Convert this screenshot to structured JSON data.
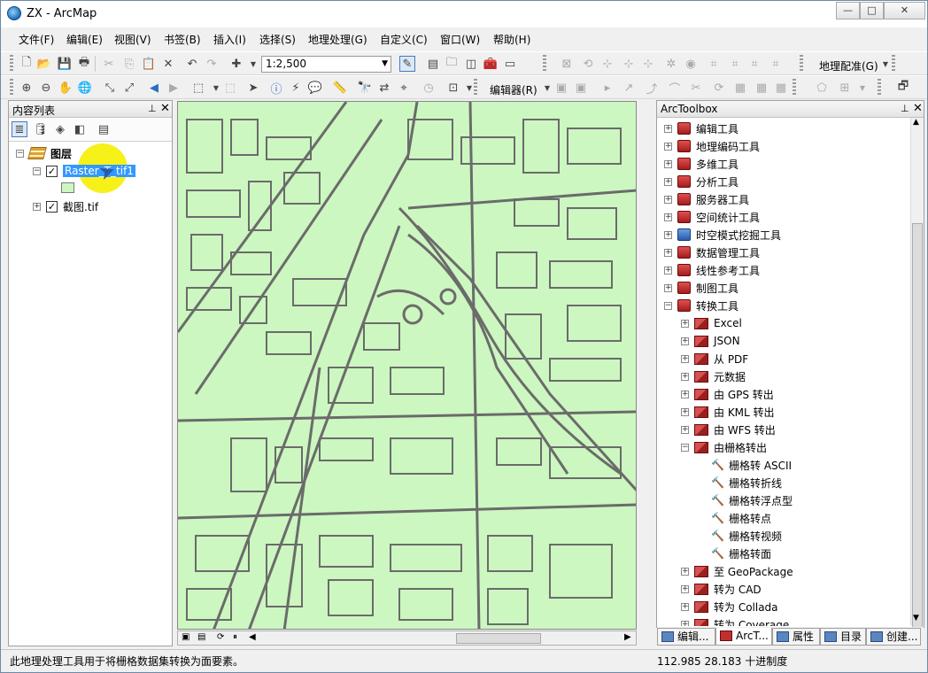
{
  "window": {
    "title": "ZX - ArcMap",
    "min": "—",
    "max": "□",
    "close": "✕"
  },
  "menu": [
    "文件(F)",
    "编辑(E)",
    "视图(V)",
    "书签(B)",
    "插入(I)",
    "选择(S)",
    "地理处理(G)",
    "自定义(C)",
    "窗口(W)",
    "帮助(H)"
  ],
  "toolbar1": {
    "scale_value": "1:2,500",
    "georef_label": "地理配准(G)"
  },
  "toolbar2": {
    "editor_label": "编辑器(R)"
  },
  "toc": {
    "title": "内容列表",
    "group_label": "图层",
    "layers": [
      {
        "label": "Raster_T_tif1",
        "checked": "✓",
        "expanded": "−"
      },
      {
        "label": "截图.tif",
        "checked": "✓",
        "expanded": "+"
      }
    ]
  },
  "toolbox": {
    "title": "ArcToolbox",
    "items": [
      {
        "label": "编辑工具",
        "expander": "+"
      },
      {
        "label": "地理编码工具",
        "expander": "+"
      },
      {
        "label": "多维工具",
        "expander": "+"
      },
      {
        "label": "分析工具",
        "expander": "+"
      },
      {
        "label": "服务器工具",
        "expander": "+"
      },
      {
        "label": "空间统计工具",
        "expander": "+"
      },
      {
        "label": "时空模式挖掘工具",
        "expander": "+"
      },
      {
        "label": "数据管理工具",
        "expander": "+"
      },
      {
        "label": "线性参考工具",
        "expander": "+"
      },
      {
        "label": "制图工具",
        "expander": "+"
      },
      {
        "label": "转换工具",
        "expander": "−"
      },
      {
        "label": "Excel",
        "expander": "+"
      },
      {
        "label": "JSON",
        "expander": "+"
      },
      {
        "label": "从 PDF",
        "expander": "+"
      },
      {
        "label": "元数据",
        "expander": "+"
      },
      {
        "label": "由 GPS 转出",
        "expander": "+"
      },
      {
        "label": "由 KML 转出",
        "expander": "+"
      },
      {
        "label": "由 WFS 转出",
        "expander": "+"
      },
      {
        "label": "由栅格转出",
        "expander": "−"
      },
      {
        "label": "栅格转 ASCII"
      },
      {
        "label": "栅格转折线"
      },
      {
        "label": "栅格转浮点型"
      },
      {
        "label": "栅格转点"
      },
      {
        "label": "栅格转视频"
      },
      {
        "label": "栅格转面"
      },
      {
        "label": "至 GeoPackage",
        "expander": "+"
      },
      {
        "label": "转为 CAD",
        "expander": "+"
      },
      {
        "label": "转为 Collada",
        "expander": "+"
      },
      {
        "label": "转为 Coverage",
        "expander": "+"
      }
    ]
  },
  "tabs": [
    "编辑...",
    "ArcT...",
    "属性",
    "目录",
    "创建..."
  ],
  "status": {
    "message": "此地理处理工具用于将栅格数据集转换为面要素。",
    "coords": "112.985  28.183 十进制度"
  },
  "colors": {
    "map_fill": "#ccf7c0",
    "map_lines": "#6b6b6b",
    "selection": "#3399ff",
    "highlight": "#f5f000"
  }
}
